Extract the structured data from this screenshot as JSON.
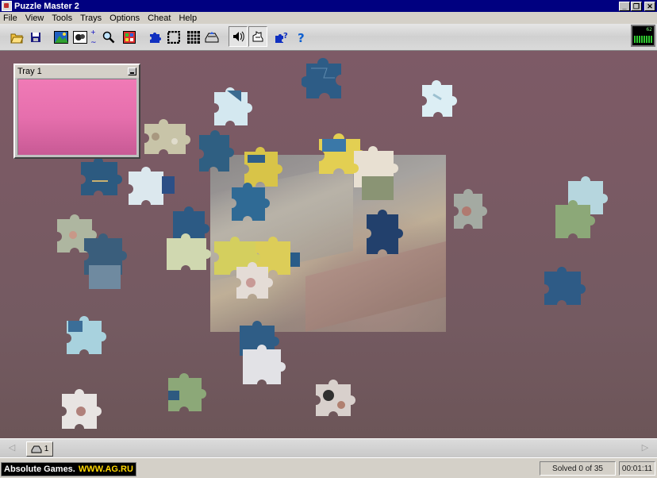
{
  "window": {
    "title": "Puzzle Master 2",
    "minimize_glyph": "_",
    "maximize_glyph": "❐",
    "close_glyph": "✕"
  },
  "menu": [
    "File",
    "View",
    "Tools",
    "Trays",
    "Options",
    "Cheat",
    "Help"
  ],
  "toolbar": {
    "buttons": [
      "open-icon",
      "save-icon",
      "picture-icon",
      "box-art-icon",
      "zoom-icon",
      "puzzle-grid-icon",
      "piece-icon",
      "edge-icon",
      "grid-icon",
      "tray-icon",
      "sound-icon",
      "ghost-icon",
      "hint-icon",
      "help-icon"
    ],
    "monitor_label": "62"
  },
  "tray": {
    "title": "Tray 1",
    "color": "#f07ab6"
  },
  "tray_tabs": {
    "tab_label": "1"
  },
  "status": {
    "brand_name": "Absolute Games.",
    "brand_url": "WWW.AG.RU",
    "solved_text": "Solved 0 of 35",
    "timer": "00:01:11"
  }
}
